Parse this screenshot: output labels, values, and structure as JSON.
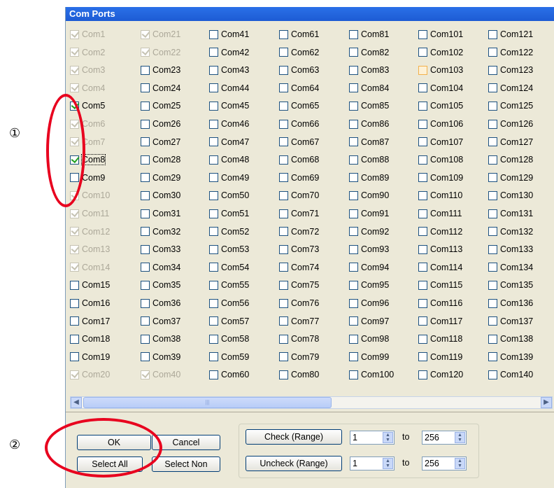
{
  "window": {
    "title": "Com Ports"
  },
  "callouts": {
    "one": "①",
    "two": "②"
  },
  "columns": [
    [
      {
        "label": "Com1",
        "checked": true,
        "disabled": true
      },
      {
        "label": "Com2",
        "checked": true,
        "disabled": true
      },
      {
        "label": "Com3",
        "checked": true,
        "disabled": true
      },
      {
        "label": "Com4",
        "checked": true,
        "disabled": true
      },
      {
        "label": "Com5",
        "checked": true,
        "disabled": false
      },
      {
        "label": "Com6",
        "checked": true,
        "disabled": true
      },
      {
        "label": "Com7",
        "checked": true,
        "disabled": true
      },
      {
        "label": "Com8",
        "checked": true,
        "disabled": false,
        "focused": true
      },
      {
        "label": "Com9",
        "checked": false,
        "disabled": false
      },
      {
        "label": "Com10",
        "checked": true,
        "disabled": true
      },
      {
        "label": "Com11",
        "checked": true,
        "disabled": true
      },
      {
        "label": "Com12",
        "checked": true,
        "disabled": true
      },
      {
        "label": "Com13",
        "checked": true,
        "disabled": true
      },
      {
        "label": "Com14",
        "checked": true,
        "disabled": true
      },
      {
        "label": "Com15",
        "checked": false,
        "disabled": false
      },
      {
        "label": "Com16",
        "checked": false,
        "disabled": false
      },
      {
        "label": "Com17",
        "checked": false,
        "disabled": false
      },
      {
        "label": "Com18",
        "checked": false,
        "disabled": false
      },
      {
        "label": "Com19",
        "checked": false,
        "disabled": false
      },
      {
        "label": "Com20",
        "checked": true,
        "disabled": true
      }
    ],
    [
      {
        "label": "Com21",
        "checked": true,
        "disabled": true
      },
      {
        "label": "Com22",
        "checked": true,
        "disabled": true
      },
      {
        "label": "Com23"
      },
      {
        "label": "Com24"
      },
      {
        "label": "Com25"
      },
      {
        "label": "Com26"
      },
      {
        "label": "Com27"
      },
      {
        "label": "Com28"
      },
      {
        "label": "Com29"
      },
      {
        "label": "Com30"
      },
      {
        "label": "Com31"
      },
      {
        "label": "Com32"
      },
      {
        "label": "Com33"
      },
      {
        "label": "Com34"
      },
      {
        "label": "Com35"
      },
      {
        "label": "Com36"
      },
      {
        "label": "Com37"
      },
      {
        "label": "Com38"
      },
      {
        "label": "Com39"
      },
      {
        "label": "Com40",
        "checked": true,
        "disabled": true
      }
    ],
    [
      {
        "label": "Com41"
      },
      {
        "label": "Com42"
      },
      {
        "label": "Com43"
      },
      {
        "label": "Com44"
      },
      {
        "label": "Com45"
      },
      {
        "label": "Com46"
      },
      {
        "label": "Com47"
      },
      {
        "label": "Com48"
      },
      {
        "label": "Com49"
      },
      {
        "label": "Com50"
      },
      {
        "label": "Com51"
      },
      {
        "label": "Com52"
      },
      {
        "label": "Com53"
      },
      {
        "label": "Com54"
      },
      {
        "label": "Com55"
      },
      {
        "label": "Com56"
      },
      {
        "label": "Com57"
      },
      {
        "label": "Com58"
      },
      {
        "label": "Com59"
      },
      {
        "label": "Com60"
      }
    ],
    [
      {
        "label": "Com61"
      },
      {
        "label": "Com62"
      },
      {
        "label": "Com63"
      },
      {
        "label": "Com64"
      },
      {
        "label": "Com65"
      },
      {
        "label": "Com66"
      },
      {
        "label": "Com67"
      },
      {
        "label": "Com68"
      },
      {
        "label": "Com69"
      },
      {
        "label": "Com70"
      },
      {
        "label": "Com71"
      },
      {
        "label": "Com72"
      },
      {
        "label": "Com73"
      },
      {
        "label": "Com74"
      },
      {
        "label": "Com75"
      },
      {
        "label": "Com76"
      },
      {
        "label": "Com77"
      },
      {
        "label": "Com78"
      },
      {
        "label": "Com79"
      },
      {
        "label": "Com80"
      }
    ],
    [
      {
        "label": "Com81"
      },
      {
        "label": "Com82"
      },
      {
        "label": "Com83"
      },
      {
        "label": "Com84"
      },
      {
        "label": "Com85"
      },
      {
        "label": "Com86"
      },
      {
        "label": "Com87"
      },
      {
        "label": "Com88"
      },
      {
        "label": "Com89"
      },
      {
        "label": "Com90"
      },
      {
        "label": "Com91"
      },
      {
        "label": "Com92"
      },
      {
        "label": "Com93"
      },
      {
        "label": "Com94"
      },
      {
        "label": "Com95"
      },
      {
        "label": "Com96"
      },
      {
        "label": "Com97"
      },
      {
        "label": "Com98"
      },
      {
        "label": "Com99"
      },
      {
        "label": "Com100"
      }
    ],
    [
      {
        "label": "Com101"
      },
      {
        "label": "Com102"
      },
      {
        "label": "Com103",
        "hover": true
      },
      {
        "label": "Com104"
      },
      {
        "label": "Com105"
      },
      {
        "label": "Com106"
      },
      {
        "label": "Com107"
      },
      {
        "label": "Com108"
      },
      {
        "label": "Com109"
      },
      {
        "label": "Com110"
      },
      {
        "label": "Com111"
      },
      {
        "label": "Com112"
      },
      {
        "label": "Com113"
      },
      {
        "label": "Com114"
      },
      {
        "label": "Com115"
      },
      {
        "label": "Com116"
      },
      {
        "label": "Com117"
      },
      {
        "label": "Com118"
      },
      {
        "label": "Com119"
      },
      {
        "label": "Com120"
      }
    ],
    [
      {
        "label": "Com121"
      },
      {
        "label": "Com122"
      },
      {
        "label": "Com123"
      },
      {
        "label": "Com124"
      },
      {
        "label": "Com125"
      },
      {
        "label": "Com126"
      },
      {
        "label": "Com127"
      },
      {
        "label": "Com128"
      },
      {
        "label": "Com129"
      },
      {
        "label": "Com130"
      },
      {
        "label": "Com131"
      },
      {
        "label": "Com132"
      },
      {
        "label": "Com133"
      },
      {
        "label": "Com134"
      },
      {
        "label": "Com135"
      },
      {
        "label": "Com136"
      },
      {
        "label": "Com137"
      },
      {
        "label": "Com138"
      },
      {
        "label": "Com139"
      },
      {
        "label": "Com140"
      }
    ]
  ],
  "buttons": {
    "ok": "OK",
    "cancel": "Cancel",
    "select_all": "Select All",
    "select_none": "Select Non",
    "check_range": "Check (Range)",
    "uncheck_range": "Uncheck (Range)"
  },
  "range": {
    "check_from": "1",
    "check_to": "256",
    "uncheck_from": "1",
    "uncheck_to": "256",
    "to_label": "to"
  },
  "colors": {
    "highlight": "#e8001e",
    "titlebar": "#1d5bd4"
  },
  "icons": {
    "scroll_left": "◀",
    "scroll_right": "▶",
    "spin": "spin-updown-icon"
  }
}
